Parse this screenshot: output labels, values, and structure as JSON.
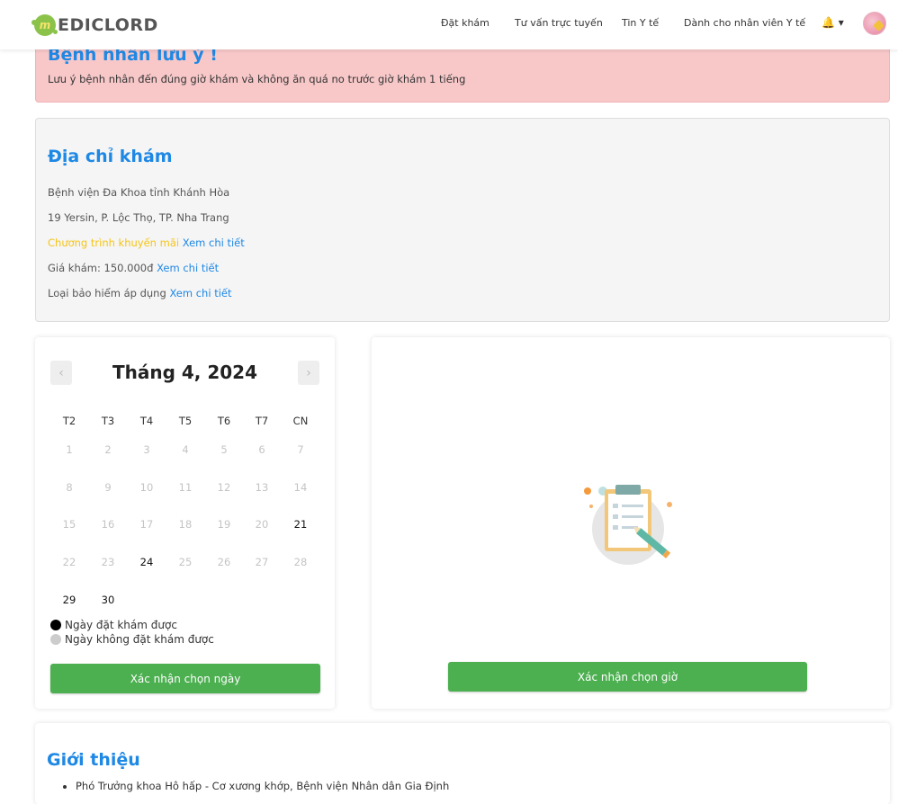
{
  "header": {
    "logo_letter": "m",
    "logo_text": "EDICLORD",
    "nav": [
      "Đặt khám",
      "Tư vấn trực tuyến",
      "Tin Y tế",
      "Dành cho nhân viên Y tế"
    ],
    "bell": "🔔 ▾"
  },
  "alert": {
    "title": "Bệnh nhân lưu ý !",
    "text": "Lưu ý bệnh nhân đến đúng giờ khám và không ăn quá no trước giờ khám 1 tiếng"
  },
  "address": {
    "title": "Địa chỉ khám",
    "hospital": "Bệnh viện Đa Khoa tỉnh Khánh Hòa",
    "street": "19 Yersin, P. Lộc Thọ, TP. Nha Trang",
    "promo_label": "Chương trình khuyến mãi",
    "price_label": "Giá khám: 150.000đ",
    "insurance_label": "Loại bảo hiểm áp dụng",
    "detail_link": "Xem chi tiết"
  },
  "calendar": {
    "title": "Tháng 4, 2024",
    "prev": "‹",
    "next": "›",
    "weekdays": [
      "T2",
      "T3",
      "T4",
      "T5",
      "T6",
      "T7",
      "CN"
    ],
    "days": [
      "1",
      "2",
      "3",
      "4",
      "5",
      "6",
      "7",
      "8",
      "9",
      "10",
      "11",
      "12",
      "13",
      "14",
      "15",
      "16",
      "17",
      "18",
      "19",
      "20",
      "21",
      "22",
      "23",
      "24",
      "25",
      "26",
      "27",
      "28",
      "29",
      "30"
    ],
    "available_days": [
      "21",
      "24",
      "29",
      "30"
    ],
    "legend_available": "Ngày đặt khám được",
    "legend_unavailable": "Ngày không đặt khám được",
    "confirm_day": "Xác nhận chọn ngày",
    "colors": {
      "available": "#111111",
      "unavailable": "#c4c4c4",
      "button": "#4caf50"
    }
  },
  "time": {
    "confirm_time": "Xác nhận chọn giờ"
  },
  "intro": {
    "title": "Giới thiệu",
    "items": [
      "Phó Trưởng khoa Hô hấp - Cơ xương khớp, Bệnh viện Nhân dân Gia Định"
    ]
  }
}
